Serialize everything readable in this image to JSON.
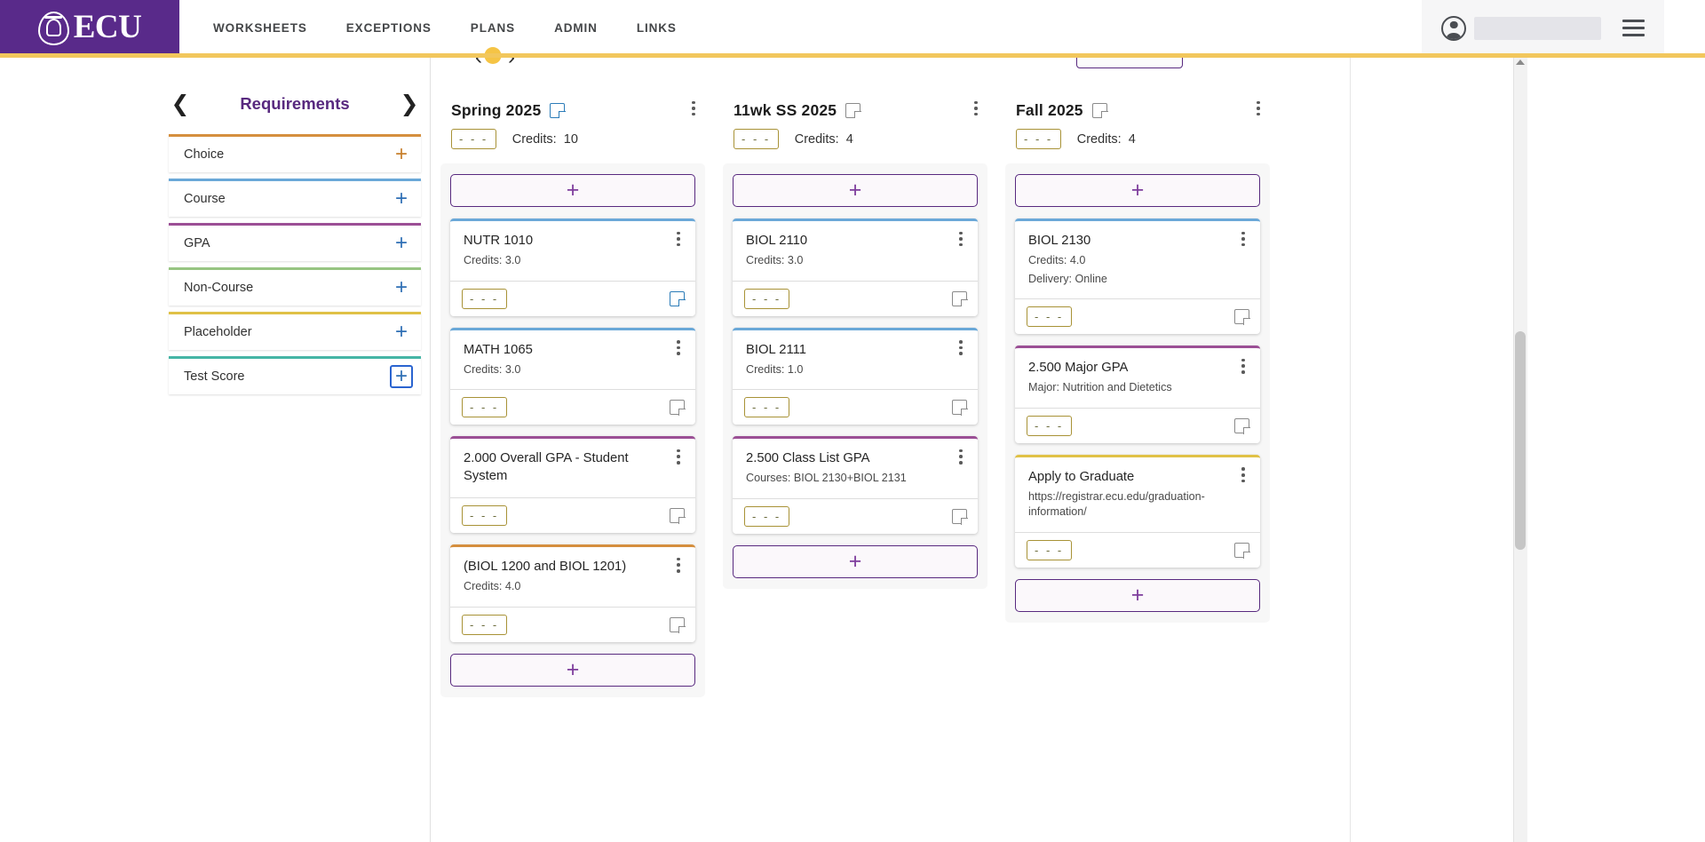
{
  "header": {
    "brand": "ECU",
    "brand_icon": "ecu-seal-icon",
    "nav": [
      {
        "label": "WORKSHEETS",
        "active": false
      },
      {
        "label": "EXCEPTIONS",
        "active": false
      },
      {
        "label": "PLANS",
        "active": true
      },
      {
        "label": "ADMIN",
        "active": false
      },
      {
        "label": "LINKS",
        "active": false
      }
    ],
    "user_name": "",
    "avatar_icon": "user-avatar-icon",
    "menu_icon": "hamburger-menu-icon"
  },
  "sidebar": {
    "title": "Requirements",
    "prev_icon": "chevron-left-icon",
    "next_icon": "chevron-right-icon",
    "add_icon": "plus-icon",
    "items": [
      {
        "label": "Choice",
        "color": "#d58f3e",
        "plus_color": "#c77f2c",
        "focused": false
      },
      {
        "label": "Course",
        "color": "#6aa8d8",
        "plus_color": "#2f6fb5",
        "focused": false
      },
      {
        "label": "GPA",
        "color": "#9b4f95",
        "plus_color": "#2f6fb5",
        "focused": false
      },
      {
        "label": "Non-Course",
        "color": "#97c582",
        "plus_color": "#2f6fb5",
        "focused": false
      },
      {
        "label": "Placeholder",
        "color": "#e0c146",
        "plus_color": "#2f6fb5",
        "focused": false
      },
      {
        "label": "Test Score",
        "color": "#45b5a5",
        "plus_color": "#2f6fb5",
        "focused": true
      }
    ]
  },
  "board": {
    "credits_label": "Credits:",
    "dash_value": "- - -",
    "add_icon": "plus-icon",
    "menu_icon": "more-vertical-icon",
    "note_icon": "note-icon",
    "terms": [
      {
        "name": "Spring 2025",
        "credits": "10",
        "note_active": true,
        "cards": [
          {
            "title": "NUTR 1010",
            "sub": "Credits: 3.0",
            "sub2": "",
            "type": "t-course",
            "note_active": true
          },
          {
            "title": "MATH 1065",
            "sub": "Credits: 3.0",
            "sub2": "",
            "type": "t-course",
            "note_active": false
          },
          {
            "title": "2.000 Overall GPA - Student System",
            "sub": "",
            "sub2": "",
            "type": "t-gpa",
            "note_active": false
          },
          {
            "title": "(BIOL 1200 and BIOL 1201)",
            "sub": "Credits: 4.0",
            "sub2": "",
            "type": "t-choice",
            "note_active": false
          }
        ]
      },
      {
        "name": "11wk SS 2025",
        "credits": "4",
        "note_active": false,
        "cards": [
          {
            "title": "BIOL 2110",
            "sub": "Credits: 3.0",
            "sub2": "",
            "type": "t-course",
            "note_active": false
          },
          {
            "title": "BIOL 2111",
            "sub": "Credits: 1.0",
            "sub2": "",
            "type": "t-course",
            "note_active": false
          },
          {
            "title": "2.500 Class List GPA",
            "sub": "Courses: BIOL 2130+BIOL 2131",
            "sub2": "",
            "type": "t-gpa",
            "note_active": false
          }
        ]
      },
      {
        "name": "Fall 2025",
        "credits": "4",
        "note_active": false,
        "cards": [
          {
            "title": "BIOL 2130",
            "sub": "Credits: 4.0",
            "sub2": "Delivery: Online",
            "type": "t-course",
            "note_active": false
          },
          {
            "title": "2.500 Major GPA",
            "sub": "Major: Nutrition and Dietetics",
            "sub2": "",
            "type": "t-gpa",
            "note_active": false
          },
          {
            "title": "Apply to Graduate",
            "sub": "https://registrar.ecu.edu/graduation-information/",
            "sub2": "",
            "type": "t-placeholder",
            "note_active": false
          }
        ]
      }
    ]
  }
}
